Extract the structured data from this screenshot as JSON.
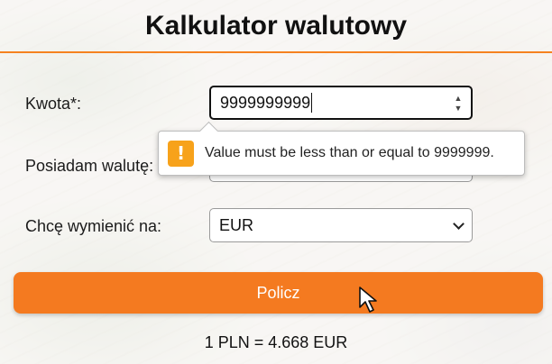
{
  "header": {
    "title": "Kalkulator walutowy"
  },
  "form": {
    "amount": {
      "label": "Kwota*:",
      "value": "9999999999"
    },
    "have_currency": {
      "label": "Posiadam walutę:"
    },
    "want_currency": {
      "label": "Chcę wymienić na:",
      "selected": "EUR"
    },
    "validation": {
      "icon": "!",
      "message": "Value must be less than or equal to 9999999."
    }
  },
  "actions": {
    "calculate_label": "Policz"
  },
  "result": {
    "rate_text": "1 PLN = 4.668 EUR"
  },
  "colors": {
    "accent": "#f47a20",
    "warning": "#f7a21b"
  },
  "icons": {
    "warning": "warning-icon",
    "select": "chevron-down-icon",
    "cursor": "mouse-pointer-icon"
  }
}
